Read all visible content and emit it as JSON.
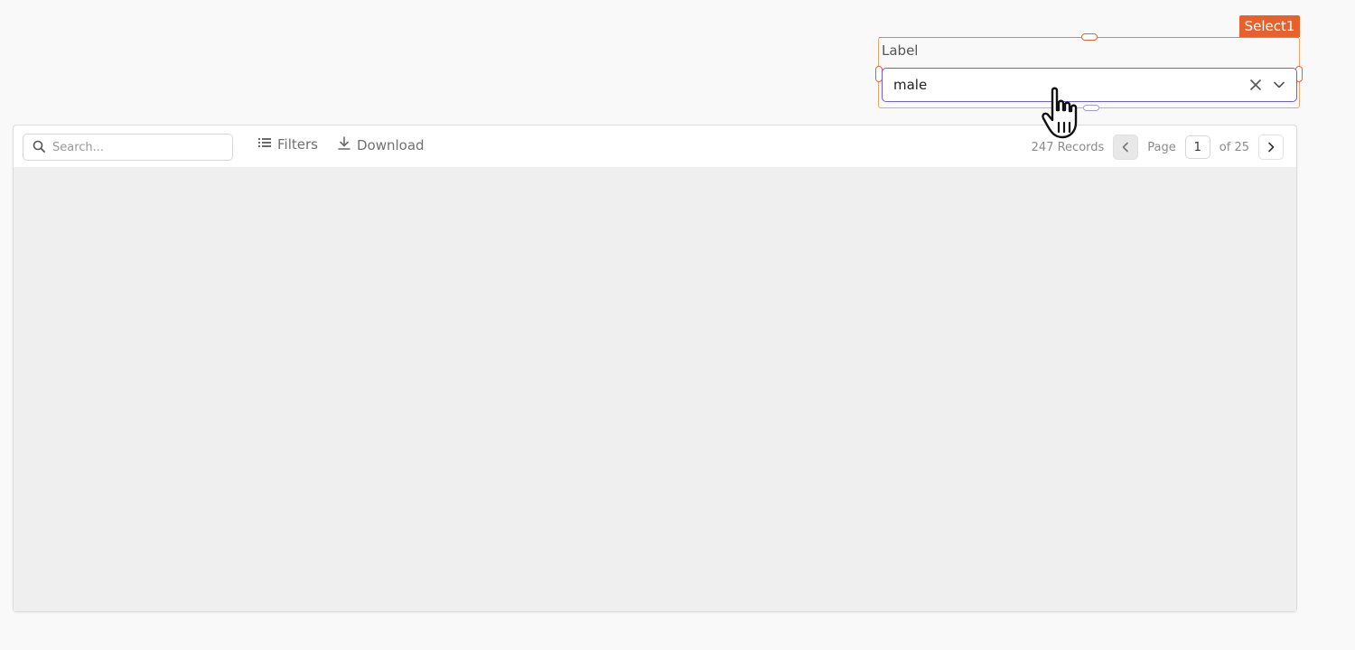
{
  "select_widget": {
    "tag": "Select1",
    "label": "Label",
    "value": "male"
  },
  "table": {
    "search_placeholder": "Search...",
    "filters_label": "Filters",
    "download_label": "Download",
    "records_text": "247 Records",
    "page_label": "Page",
    "current_page": "1",
    "of_pages": "of 25"
  },
  "colors": {
    "selection_accent": "#e8602c",
    "focus_border": "#6c5ce7"
  },
  "icons": {
    "search": "search-icon",
    "filters": "filter-list-icon",
    "download": "download-icon",
    "clear": "close-icon",
    "dropdown": "chevron-down-icon",
    "prev": "chevron-left-icon",
    "next": "chevron-right-icon",
    "cursor": "hand-pointer-cursor-icon"
  }
}
